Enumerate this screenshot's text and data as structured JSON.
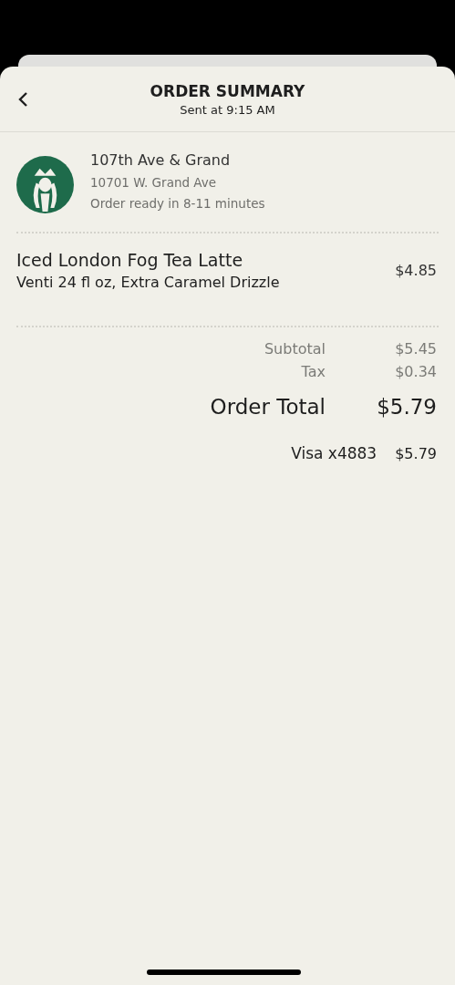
{
  "header": {
    "title": "ORDER SUMMARY",
    "subtitle": "Sent at 9:15 AM"
  },
  "store": {
    "name": "107th Ave & Grand",
    "address": "10701 W. Grand Ave",
    "ready": "Order ready in 8-11 minutes"
  },
  "items": [
    {
      "name": "Iced London Fog Tea Latte",
      "details": "Venti 24 fl oz, Extra Caramel Drizzle",
      "price": "$4.85"
    }
  ],
  "totals": [
    {
      "kind": "minor",
      "label": "Subtotal",
      "value": "$5.45"
    },
    {
      "kind": "minor",
      "label": "Tax",
      "value": "$0.34"
    },
    {
      "kind": "total",
      "label": "Order Total",
      "value": "$5.79"
    }
  ],
  "payment": {
    "method": "Visa x4883",
    "amount": "$5.79"
  }
}
